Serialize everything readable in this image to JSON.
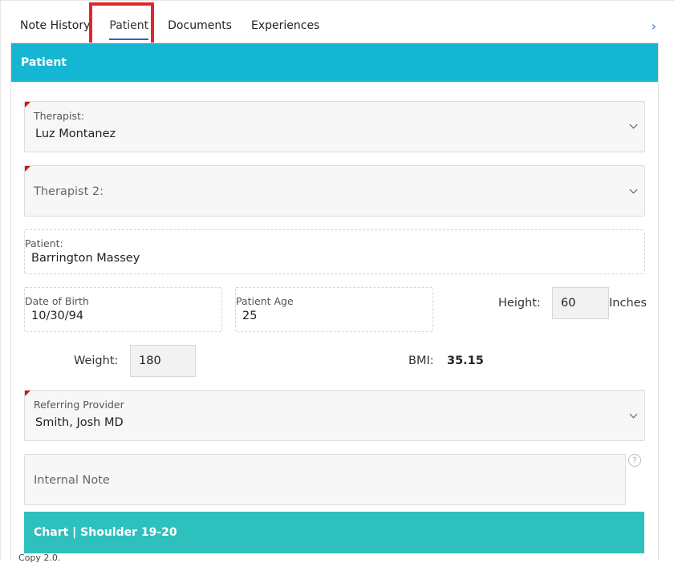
{
  "tabs": [
    {
      "label": "Note History"
    },
    {
      "label": "Patient"
    },
    {
      "label": "Documents"
    },
    {
      "label": "Experiences"
    }
  ],
  "panel": {
    "title": "Patient"
  },
  "therapist": {
    "label": "Therapist:",
    "value": "Luz Montanez"
  },
  "therapist2": {
    "placeholder": "Therapist 2:"
  },
  "patient": {
    "label": "Patient:",
    "value": "Barrington Massey"
  },
  "dob": {
    "label": "Date of Birth",
    "value": "10/30/94"
  },
  "age": {
    "label": "Patient Age",
    "value": "25"
  },
  "height": {
    "label": "Height:",
    "value": "60",
    "unit": "Inches"
  },
  "weight": {
    "label": "Weight:",
    "value": "180"
  },
  "bmi": {
    "label": "BMI:",
    "value": "35.15"
  },
  "referring": {
    "label": "Referring Provider",
    "value": "Smith, Josh MD"
  },
  "internal_note": {
    "placeholder": "Internal Note",
    "help": "?"
  },
  "chart": {
    "title": "Chart | Shoulder 19-20"
  },
  "footer": {
    "text": "Copy 2.0."
  },
  "icons": {
    "next": "chevron-right-icon",
    "dropdown": "chevron-down-icon",
    "help": "question-circle-icon"
  },
  "colors": {
    "header": "#14b6d3",
    "chart_header": "#2ec0bd",
    "active_tab": "#2a67b7",
    "highlight": "#e0262b",
    "required": "#d0141b"
  }
}
